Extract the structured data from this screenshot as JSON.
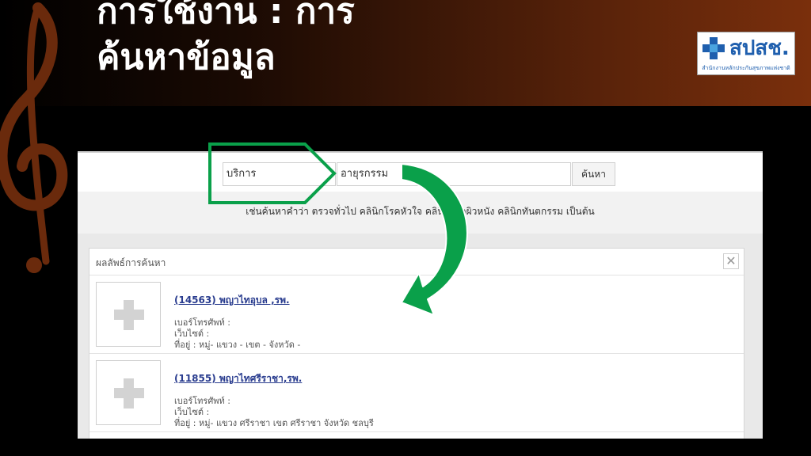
{
  "slide": {
    "title_line1": "การใช้งาน : การ",
    "title_line2": "ค้นหาข้อมูล"
  },
  "logo": {
    "name": "สปสช.",
    "subtitle": "สำนักงานหลักประกันสุขภาพแห่งชาติ"
  },
  "search": {
    "service_value": "บริการ",
    "keyword_value": "อายุรกรรม",
    "button_label": "ค้นหา",
    "hint": "เช่นค้นหาคำว่า ตรวจทั่วไป คลินิกโรคหัวใจ คลินิกโรคผิวหนัง คลินิกทันตกรรม เป็นต้น"
  },
  "results": {
    "panel_title": "ผลลัพธ์การค้นหา",
    "close_glyph": "✕",
    "items": [
      {
        "title": "(14563) พญาไทอุบล ,รพ.",
        "phone": "เบอร์โทรศัพท์ :",
        "website": "เว็บไซต์ :",
        "address": "ที่อยู่ : หมู่- แขวง - เขต - จังหวัด -"
      },
      {
        "title": "(11855) พญาไทศรีราชา,รพ.",
        "phone": "เบอร์โทรศัพท์ :",
        "website": "เว็บไซต์ :",
        "address": "ที่อยู่ : หมู่- แขวง ศรีราชา เขต ศรีราชา จังหวัด ชลบุรี"
      }
    ]
  },
  "colors": {
    "annotation_green": "#0aa04a",
    "link_blue": "#2a3d8f",
    "brand_blue": "#1f5fae"
  },
  "icons": {
    "placeholder": "plus-icon",
    "clef": "treble-clef-icon",
    "arrow": "curved-arrow-icon",
    "highlight": "pentagon-outline"
  }
}
